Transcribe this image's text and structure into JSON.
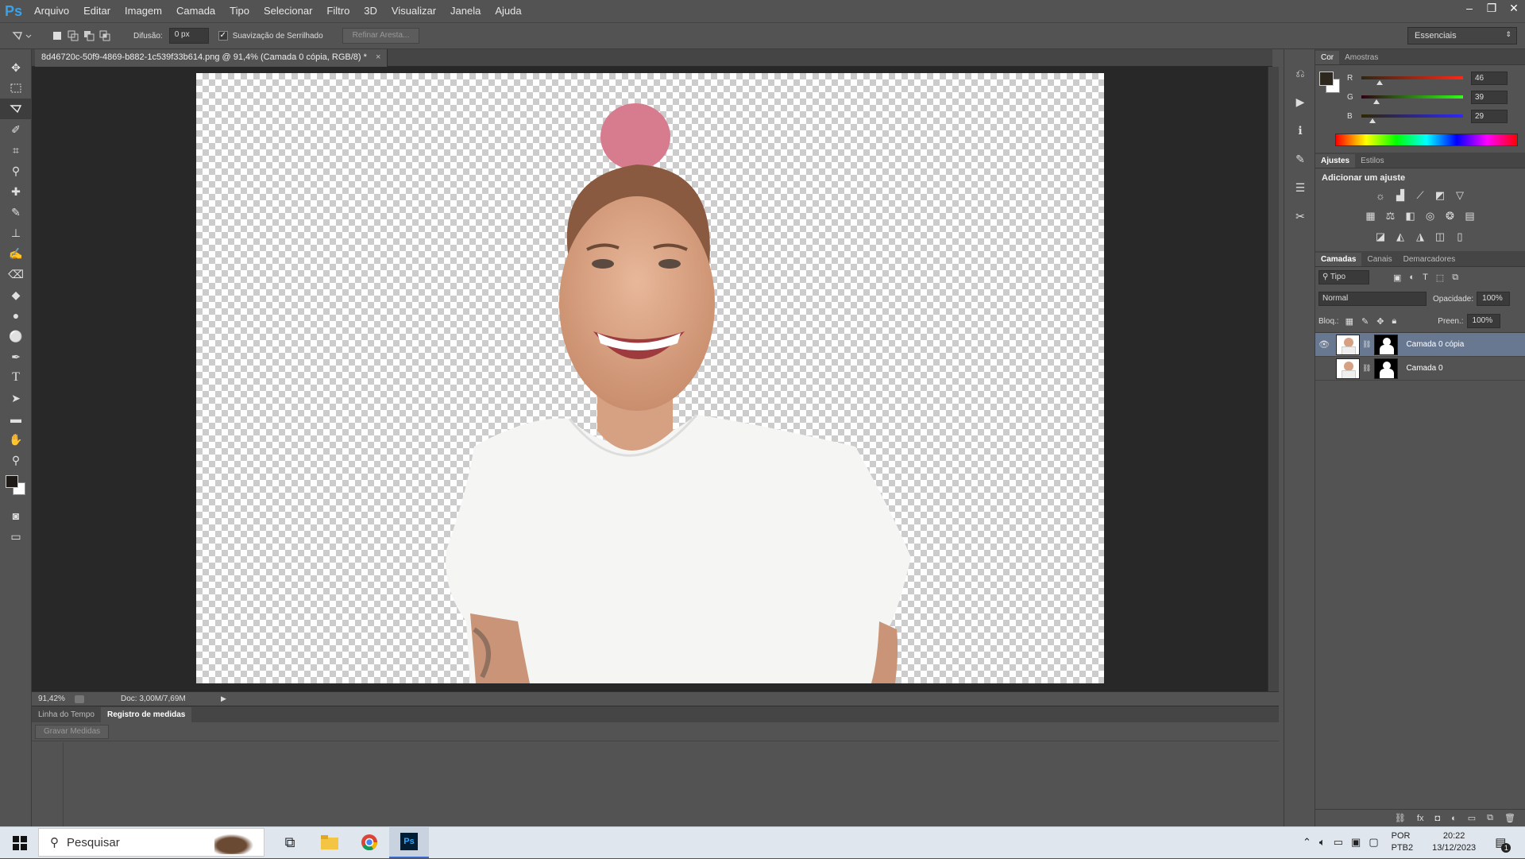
{
  "app": {
    "logo": "Ps"
  },
  "menu": [
    "Arquivo",
    "Editar",
    "Imagem",
    "Camada",
    "Tipo",
    "Selecionar",
    "Filtro",
    "3D",
    "Visualizar",
    "Janela",
    "Ajuda"
  ],
  "window_controls": {
    "minimize": "–",
    "restore": "❐",
    "close": "✕"
  },
  "options": {
    "feather_label": "Difusão:",
    "feather_value": "0 px",
    "antialias_label": "Suavização de Serrilhado",
    "antialias_checked": true,
    "refine_edge": "Refinar Aresta...",
    "workspace": "Essenciais"
  },
  "document": {
    "tab_title": "8d46720c-50f9-4869-b882-1c539f33b614.png @ 91,4% (Camada 0 cópia, RGB/8) *",
    "close": "×",
    "zoom": "91,42%",
    "doc_info": "Doc: 3,00M/7,69M"
  },
  "bottom_panel": {
    "tabs": [
      "Linha do Tempo",
      "Registro de medidas"
    ],
    "active_tab": 1,
    "record_button": "Gravar Medidas"
  },
  "color_panel": {
    "tabs": [
      "Cor",
      "Amostras"
    ],
    "foreground": "#2e271d",
    "background": "#ffffff",
    "channels": [
      {
        "label": "R",
        "value": "46",
        "fraction": 0.18,
        "gradient": "linear-gradient(to right,#2e2715,#ff2715)"
      },
      {
        "label": "G",
        "value": "39",
        "fraction": 0.15,
        "gradient": "linear-gradient(to right,#2e0015,#2eff15)"
      },
      {
        "label": "B",
        "value": "29",
        "fraction": 0.11,
        "gradient": "linear-gradient(to right,#2e2700,#2e27ff)"
      }
    ]
  },
  "adjustments_panel": {
    "tabs": [
      "Ajustes",
      "Estilos"
    ],
    "title": "Adicionar um ajuste",
    "rows": [
      [
        "brightness-icon",
        "levels-icon",
        "curves-icon",
        "exposure-icon",
        "triangle-icon"
      ],
      [
        "vibrance-icon",
        "balance-icon",
        "bw-icon",
        "photo-filter-icon",
        "channel-mixer-icon",
        "lookup-icon"
      ],
      [
        "invert-icon",
        "posterize-icon",
        "threshold-icon",
        "selective-color-icon",
        "gradient-map-icon"
      ]
    ],
    "glyphs": {
      "brightness-icon": "☼",
      "levels-icon": "▟",
      "curves-icon": "⟋",
      "exposure-icon": "◩",
      "triangle-icon": "▽",
      "vibrance-icon": "▦",
      "balance-icon": "⚖",
      "bw-icon": "◧",
      "photo-filter-icon": "◎",
      "channel-mixer-icon": "❂",
      "lookup-icon": "▤",
      "invert-icon": "◪",
      "posterize-icon": "◭",
      "threshold-icon": "◮",
      "selective-color-icon": "◫",
      "gradient-map-icon": "▯"
    }
  },
  "layers_panel": {
    "tabs": [
      "Camadas",
      "Canais",
      "Demarcadores"
    ],
    "filter": "Tipo",
    "blend_mode": "Normal",
    "opacity_label": "Opacidade:",
    "opacity": "100%",
    "lock_label": "Bloq.:",
    "fill_label": "Preen.:",
    "fill": "100%",
    "layers": [
      {
        "name": "Camada 0 cópia",
        "visible": true,
        "selected": true
      },
      {
        "name": "Camada 0",
        "visible": false,
        "selected": false
      }
    ]
  },
  "taskbar": {
    "search_placeholder": "Pesquisar",
    "lang_top": "POR",
    "lang_bottom": "PTB2",
    "time": "20:22",
    "date": "13/12/2023",
    "notification_count": "1"
  }
}
